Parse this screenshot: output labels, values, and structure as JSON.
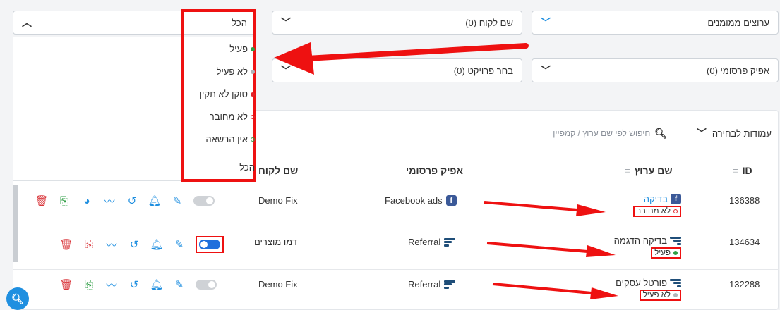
{
  "filters": {
    "status_value": "הכל",
    "client_label": "שם לקוח (0)",
    "assets_label": "ערוצים ממומנים",
    "project_label": "בחר פרויקט (0)",
    "advertiser_label": "אפיק פרסומי (0)"
  },
  "status_dropdown": {
    "options": [
      {
        "label": "פעיל",
        "color": "#2e9e44",
        "hollow": false
      },
      {
        "label": "לא פעיל",
        "color": "#b0b4b9",
        "hollow": false
      },
      {
        "label": "טוקן לא תקין",
        "color": "#e0242a",
        "hollow": false
      },
      {
        "label": "לא מחובר",
        "color": "#e0242a",
        "hollow": true
      },
      {
        "label": "אין הרשאה",
        "color": "#2e9e44",
        "hollow": true
      },
      {
        "label": "הכל",
        "color": "",
        "hollow": false
      }
    ]
  },
  "toolbar": {
    "search_placeholder": "חיפוש לפי שם ערוץ / קמפיין",
    "columns_label": "עמודות לבחירה"
  },
  "table": {
    "headers": {
      "id": "ID",
      "channel": "שם ערוץ",
      "source": "אפיק פרסומי",
      "client": "שם לקוח"
    },
    "rows": [
      {
        "id": "136388",
        "channel": "בדיקה",
        "status": "לא מחובר",
        "status_color": "#e0242a",
        "status_hollow": true,
        "source": "Facebook ads",
        "source_icon": "facebook",
        "client": "Demo Fix",
        "toggle_on": false,
        "chart_icon": true
      },
      {
        "id": "134634",
        "channel": "בדיקה הדגמה",
        "status": "פעיל",
        "status_color": "#2e9e44",
        "status_hollow": false,
        "source": "Referral",
        "source_icon": "referral",
        "client": "דמו מוצרים",
        "toggle_on": true,
        "chart_icon": false
      },
      {
        "id": "132288",
        "channel": "פורטל עסקים",
        "status": "לא פעיל",
        "status_color": "#b0b4b9",
        "status_hollow": false,
        "source": "Referral",
        "source_icon": "referral",
        "client": "Demo Fix",
        "toggle_on": false,
        "chart_icon": false
      }
    ]
  },
  "colors": {
    "accent": "#1f8fe0",
    "annotation": "#e11111"
  }
}
